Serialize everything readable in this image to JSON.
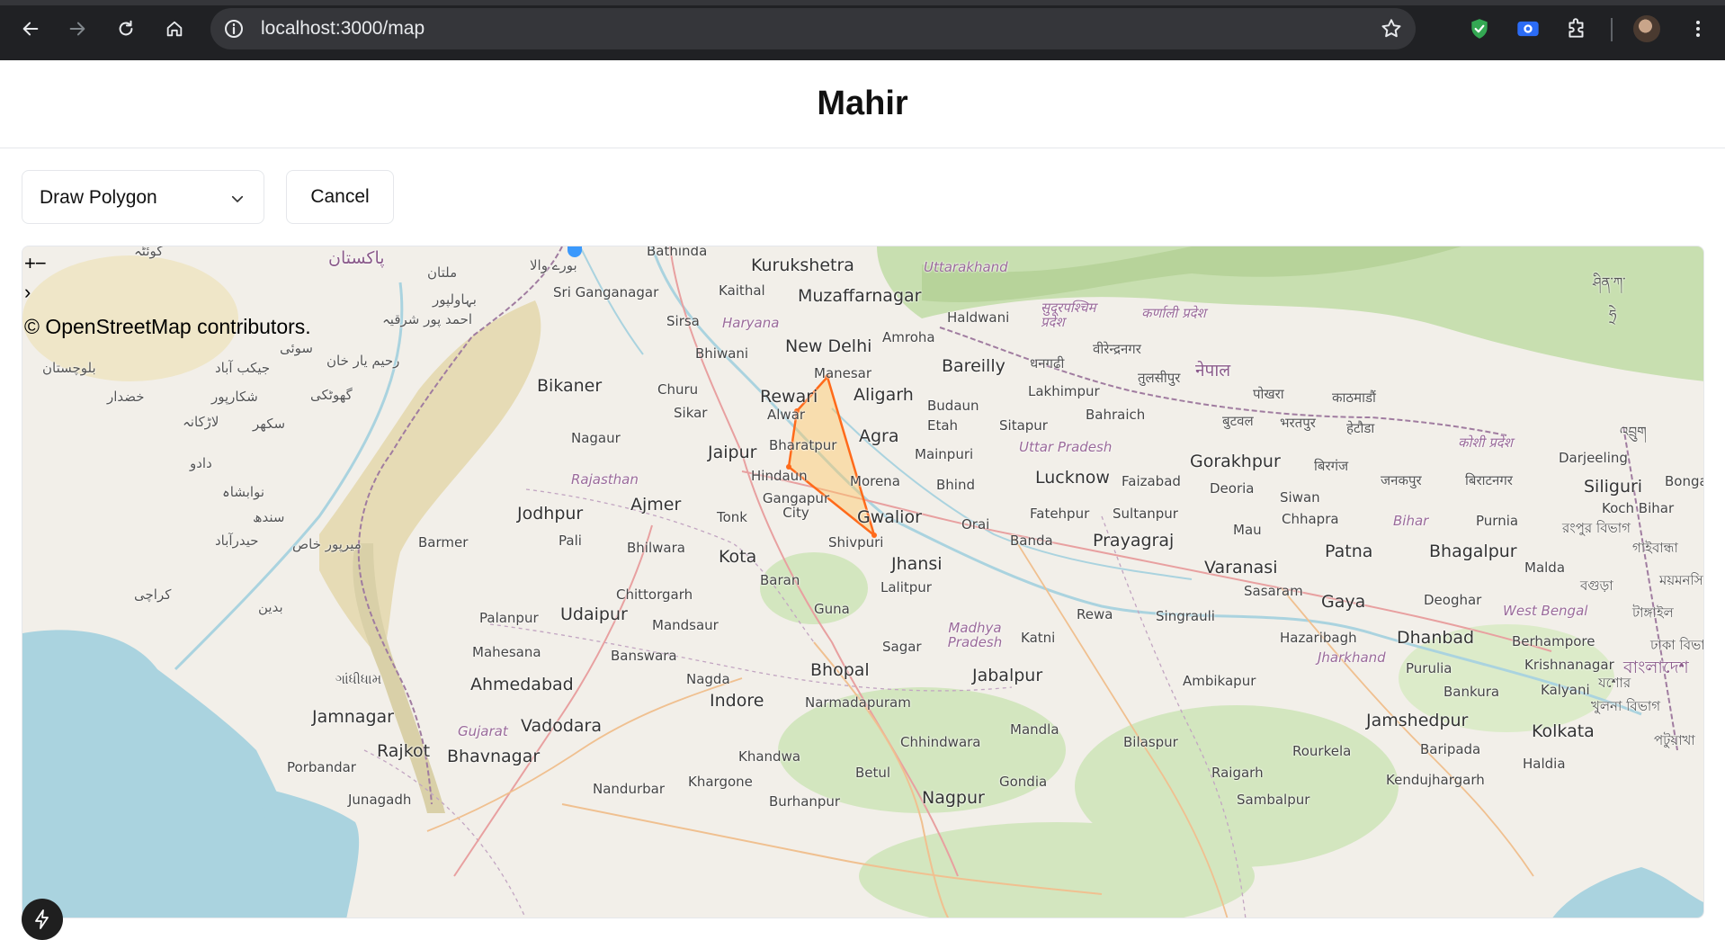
{
  "browser": {
    "url": "localhost:3000/map",
    "icons": [
      "back-arrow-icon",
      "forward-arrow-icon",
      "reload-icon",
      "home-icon",
      "site-info-icon",
      "bookmark-star-icon",
      "shield-extension-icon",
      "screen-capture-extension-icon",
      "extensions-puzzle-icon",
      "profile-avatar",
      "more-menu-icon"
    ]
  },
  "app": {
    "title": "Mahir"
  },
  "toolbar": {
    "mode_select": {
      "value": "Draw Polygon"
    },
    "cancel_label": "Cancel"
  },
  "map": {
    "zoom_in": "+",
    "zoom_out": "−",
    "attribution_toggle": "›",
    "attribution": "© OpenStreetMap contributors.",
    "polygon_color": "#ff6a1a",
    "polygon_fill": "#ffc866",
    "labels": {
      "kurukshetra": "Kurukshetra",
      "uttarakhand": "Uttarakhand",
      "bathinda": "Bathinda",
      "kaithal": "Kaithal",
      "muzaffarnagar": "Muzaffarnagar",
      "sri_ganganagar": "Sri Ganganagar",
      "sirsa": "Sirsa",
      "haryana": "Haryana",
      "haldwani": "Haldwani",
      "amroha": "Amroha",
      "bhiwani": "Bhiwani",
      "new_delhi": "New Delhi",
      "bareilly": "Bareilly",
      "manesar": "Manesar",
      "bikaner": "Bikaner",
      "churu": "Churu",
      "rewari": "Rewari",
      "aligarh": "Aligarh",
      "budaun": "Budaun",
      "lakhimpur": "Lakhimpur",
      "bahraich": "Bahraich",
      "sikar": "Sikar",
      "alwar": "Alwar",
      "etah": "Etah",
      "sitapur": "Sitapur",
      "nagaur": "Nagaur",
      "bharatpur": "Bharatpur",
      "agra": "Agra",
      "uttar_pradesh": "Uttar Pradesh",
      "jaipur": "Jaipur",
      "mainpuri": "Mainpuri",
      "gorakhpur": "Gorakhpur",
      "hindaun": "Hindaun",
      "rajasthan": "Rajasthan",
      "morena": "Morena",
      "bhind": "Bhind",
      "lucknow": "Lucknow",
      "faizabad": "Faizabad",
      "deoria": "Deoria",
      "siwan": "Siwan",
      "jodhpur": "Jodhpur",
      "ajmer": "Ajmer",
      "gangapur_city": "Gangapur City",
      "tonk": "Tonk",
      "gwalior": "Gwalior",
      "fatehpur": "Fatehpur",
      "sultanpur": "Sultanpur",
      "chhapra": "Chhapra",
      "bihar": "Bihar",
      "purnia": "Purnia",
      "orai": "Orai",
      "mau": "Mau",
      "pali": "Pali",
      "barmer": "Barmer",
      "bhilwara": "Bhilwara",
      "shivpuri": "Shivpuri",
      "banda": "Banda",
      "prayagraj": "Prayagraj",
      "patna": "Patna",
      "bhagalpur": "Bhagalpur",
      "kota": "Kota",
      "jhansi": "Jhansi",
      "varanasi": "Varanasi",
      "baran": "Baran",
      "lalitpur": "Lalitpur",
      "sasaram": "Sasaram",
      "chittorgarh": "Chittorgarh",
      "gaya": "Gaya",
      "deoghar": "Deoghar",
      "guna": "Guna",
      "palanpur": "Palanpur",
      "udaipur": "Udaipur",
      "rewa": "Rewa",
      "singrauli": "Singrauli",
      "mandsaur": "Mandsaur",
      "madhya_pradesh": "Madhya Pradesh",
      "katni": "Katni",
      "west_bengal": "West Bengal",
      "hazaribagh": "Hazaribagh",
      "dhanbad": "Dhanbad",
      "berhampore": "Berhampore",
      "mahesana": "Mahesana",
      "banswara": "Banswara",
      "sagar": "Sagar",
      "jharkhand": "Jharkhand",
      "bhopal": "Bhopal",
      "purulia": "Purulia",
      "krishnanagar": "Krishnanagar",
      "nagda": "Nagda",
      "jabalpur": "Jabalpur",
      "ambikapur": "Ambikapur",
      "ahmedabad": "Ahmedabad",
      "bankura": "Bankura",
      "kalyani": "Kalyani",
      "indore": "Indore",
      "narmadapuram": "Narmadapuram",
      "jamnagar": "Jamnagar",
      "jamshedpur": "Jamshedpur",
      "vadodara": "Vadodara",
      "gujarat": "Gujarat",
      "mandla": "Mandla",
      "kolkata": "Kolkata",
      "chhindwara": "Chhindwara",
      "bilaspur": "Bilaspur",
      "rajkot": "Rajkot",
      "bhavnagar": "Bhavnagar",
      "khandwa": "Khandwa",
      "rourkela": "Rourkela",
      "baripada": "Baripada",
      "porbandar": "Porbandar",
      "betul": "Betul",
      "raigarh": "Raigarh",
      "haldia": "Haldia",
      "khargone": "Khargone",
      "gondia": "Gondia",
      "nandurbar": "Nandurbar",
      "kendujhargarh": "Kendujhargarh",
      "junagadh": "Junagadh",
      "burhanpur": "Burhanpur",
      "nagpur": "Nagpur",
      "sambalpur": "Sambalpur",
      "darjeeling": "Darjeeling",
      "siliguri": "Siliguri",
      "koch_bihar": "Koch Bihar",
      "malda": "Malda",
      "bongaigaon_short": "Bonga",
      "pakistan": "پاکستان",
      "multan": "ملتان",
      "bahawalpur": "بہاولپور",
      "ahmedpur_sharqia": "احمد پور شرقیہ",
      "rahim_yar_khan": "رحیم یار خان",
      "sui": "سوئی",
      "jacobabad": "جیکب آباد",
      "balochistan": "بلوچستان",
      "shikarpur": "شکارپور",
      "ghotki": "گھوٹکی",
      "khuzdar": "خضدار",
      "larkana": "لاڑکانہ",
      "sukkur": "سکھر",
      "dadu": "دادو",
      "nawabshah": "نوابشاہ",
      "sindh": "سندھ",
      "hyderabad": "حیدرآباد",
      "mirpur_khas": "میرپور خاص",
      "karachi": "کراچی",
      "badin": "بدین",
      "burewala": "بورے والا",
      "quetta_short": "کوئٹہ",
      "nepal": "नेपाल",
      "sudurpaschim": "सुदूरपश्चिम प्रदेश",
      "karnali": "कर्णाली प्रदेश",
      "birendranagar": "वीरेन्द्रनगर",
      "dhangadhi": "धनगढी",
      "tulsipur": "तुलसीपुर",
      "pokhara": "पोखरा",
      "kathmandu": "काठमाडौं",
      "butwal": "बुटवल",
      "bharatpur_np": "भरतपुर",
      "hetauda": "हेटौडा",
      "koshi": "कोशी प्रदेश",
      "birgunj": "बिरगंज",
      "janakpur": "जनकपुर",
      "biratnagar": "बिराटनगर",
      "kutch": "ગાંધીધામ",
      "rangpur": "রংপুর বিভাগ",
      "bangladesh": "বাংলাদেশ",
      "bogura": "বগুড়া",
      "jessore": "যশোর",
      "khulna": "খুলনা বিভাগ",
      "dhaka": "ঢাকা বিভা",
      "tangail": "টাঙ্গাইল",
      "mymensingh": "ময়মনসিং",
      "gaibandha": "গাইবান্ধা",
      "patuakhali": "পটুয়াখা",
      "tibet_a": "ཤིན་ཀ་",
      "tibet_b": "ཧྲེ",
      "bhutan": "འབྲུག"
    }
  }
}
